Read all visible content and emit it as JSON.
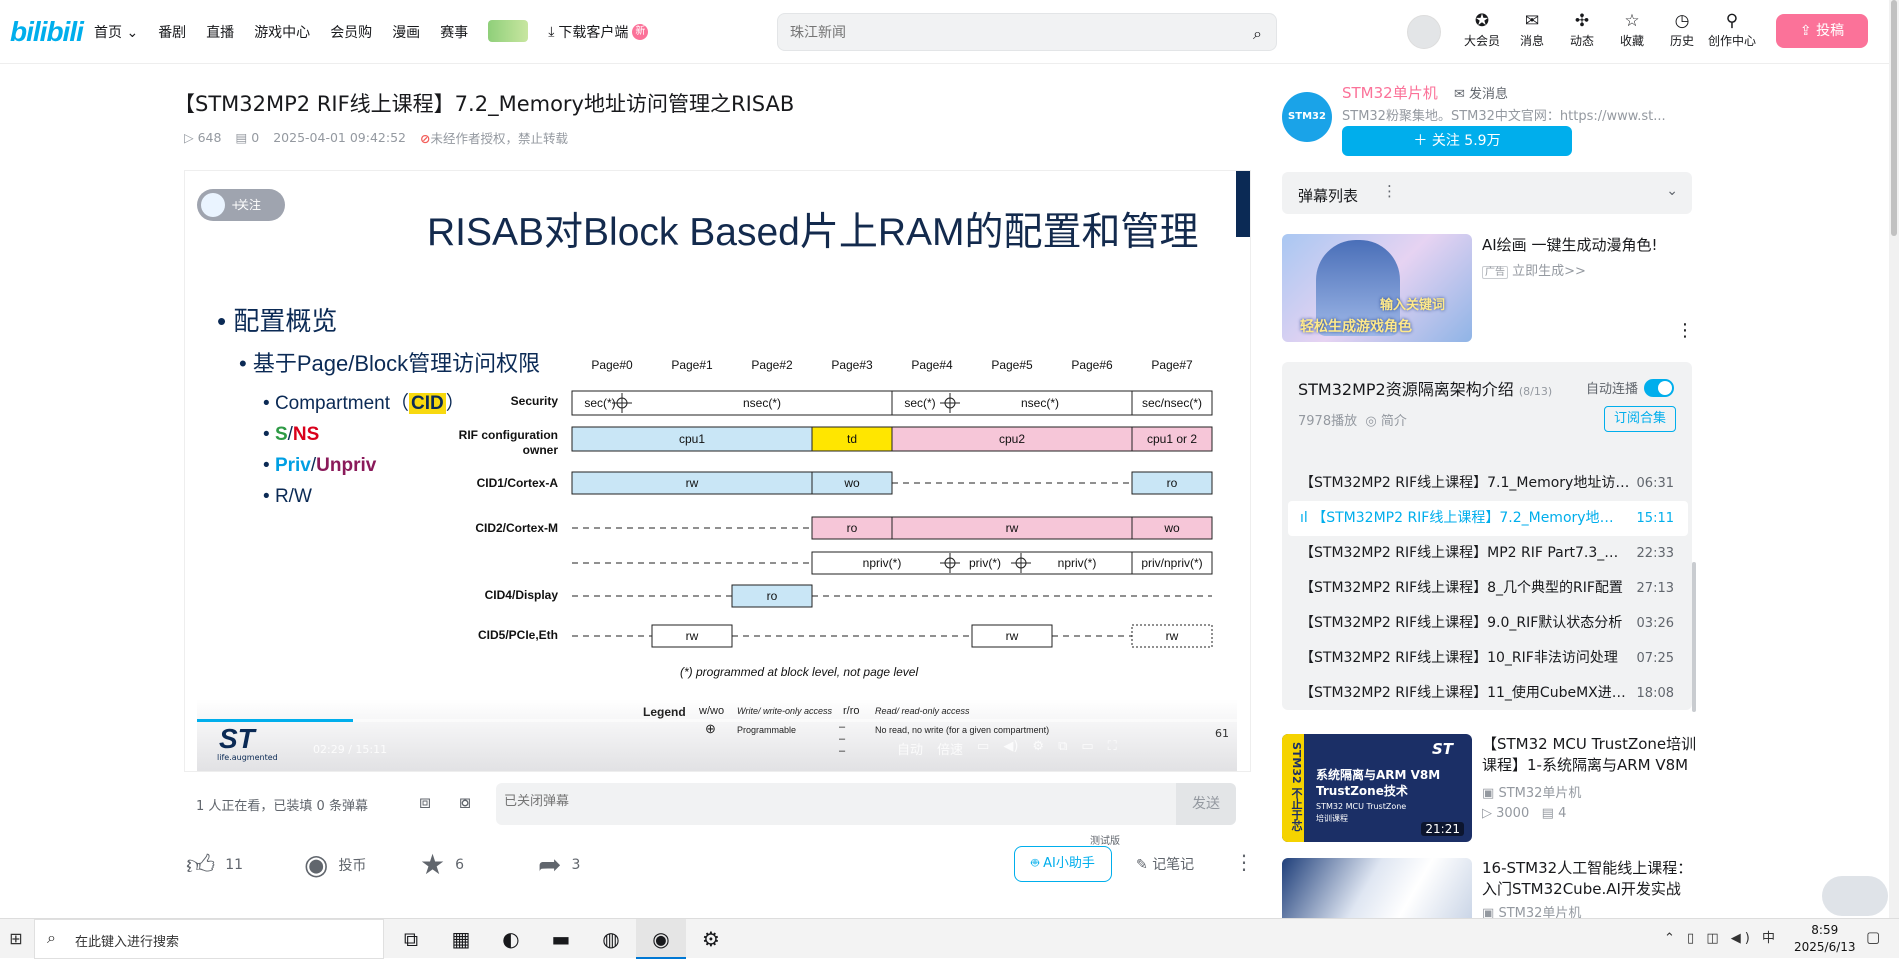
{
  "header": {
    "logo": "bilibili",
    "nav": [
      "首页",
      "番剧",
      "直播",
      "游戏中心",
      "会员购",
      "漫画",
      "赛事"
    ],
    "download_label": "下载客户端",
    "download_badge": "新",
    "search_placeholder": "珠江新闻",
    "icons": [
      {
        "icon": "vip-icon",
        "label": "大会员"
      },
      {
        "icon": "message-icon",
        "label": "消息"
      },
      {
        "icon": "dynamic-icon",
        "label": "动态"
      },
      {
        "icon": "favorite-icon",
        "label": "收藏"
      },
      {
        "icon": "history-icon",
        "label": "历史"
      },
      {
        "icon": "creator-icon",
        "label": "创作中心"
      }
    ],
    "upload_label": "投稿"
  },
  "video": {
    "title": "【STM32MP2 RIF线上课程】7.2_Memory地址访问管理之RISAB",
    "plays": "648",
    "danmaku_count": "0",
    "date": "2025-04-01 09:42:52",
    "notice": "未经作者授权，禁止转载",
    "progress_fraction": 0.15,
    "time_current": "02:29",
    "time_total": "15:11",
    "controls": [
      "自动",
      "倍速"
    ]
  },
  "slide": {
    "follow_label": "关注",
    "title": "RISAB对Block Based片上RAM的配置和管理",
    "bullet1": "配置概览",
    "bullet2": "基于Page/Block管理访问权限",
    "bullet3_prefix": "Compartment（",
    "bullet3_cid": "CID",
    "bullet3_suffix": "）",
    "s_label": "S",
    "ns_label": "NS",
    "priv_label": "Priv",
    "unpriv_label": "Unpriv",
    "slash": "/",
    "rw_label": "R/W",
    "pages": [
      "Page#0",
      "Page#1",
      "Page#2",
      "Page#3",
      "Page#4",
      "Page#5",
      "Page#6",
      "Page#7"
    ],
    "row_labels": {
      "security": "Security",
      "owner1": "RIF configuration",
      "owner2": "owner",
      "cid1": "CID1/Cortex-A",
      "cid2": "CID2/Cortex-M",
      "cid4": "CID4/Display",
      "cid5": "CID5/PCIe,Eth"
    },
    "cells": {
      "sec1": "sec(*)",
      "nsec1": "nsec(*)",
      "sec2": "sec(*)",
      "nsec2": "nsec(*)",
      "secnsec": "sec/nsec(*)",
      "cpu1": "cpu1",
      "td": "td",
      "cpu2": "cpu2",
      "cpu1or2": "cpu1 or 2",
      "rw": "rw",
      "wo": "wo",
      "ro": "ro",
      "npriv1": "npriv(*)",
      "priv": "priv(*)",
      "npriv2": "npriv(*)",
      "privnpriv": "priv/npriv(*)"
    },
    "footnote": "(*) programmed at block level, not page level",
    "legend_title": "Legend",
    "legend_wwo": "w/wo",
    "legend_wwo_desc": "Write/ write-only access",
    "legend_rro": "r/ro",
    "legend_rro_desc": "Read/ read-only access",
    "legend_prog": "Programmable",
    "legend_none": "No read, no write (for a given compartment)",
    "st_logo": "ST",
    "st_tag": "life.augmented",
    "page_num": "61"
  },
  "danmaku_bar": {
    "info": "1 人正在看，已装填 0 条弹幕",
    "placeholder": "已关闭弹幕",
    "send": "发送"
  },
  "toolbar": {
    "like": "11",
    "coin": "投币",
    "fav": "6",
    "share": "3",
    "ai_tag": "测试版",
    "ai_label": "AI小助手",
    "note": "记笔记"
  },
  "up": {
    "name": "STM32单片机",
    "message": "发消息",
    "desc": "STM32粉聚集地。STM32中文官网：https://www.st...",
    "follow": "＋ 关注 5.9万",
    "avatar_text": "STM32"
  },
  "danmaku_list": {
    "title": "弹幕列表"
  },
  "ad": {
    "title": "AI绘画 一键生成动漫角色!",
    "tag": "广告",
    "cta": "立即生成>>",
    "line1": "输入关键词",
    "line2": "轻松生成游戏角色"
  },
  "playlist": {
    "title": "STM32MP2资源隔离架构介绍",
    "count": "(8/13)",
    "auto": "自动连播",
    "plays": "7978播放",
    "intro": "简介",
    "subscribe": "订阅合集",
    "items": [
      {
        "title": "【STM32MP2 RIF线上课程】7.1_Memory地址访问管理之",
        "dur": "06:31"
      },
      {
        "title": "【STM32MP2 RIF线上课程】7.2_Memory地址访问管理之RISAB",
        "dur": "15:11"
      },
      {
        "title": "【STM32MP2 RIF线上课程】MP2 RIF Part7.3_Memory",
        "dur": "22:33"
      },
      {
        "title": "【STM32MP2 RIF线上课程】8_几个典型的RIF配置",
        "dur": "27:13"
      },
      {
        "title": "【STM32MP2 RIF线上课程】9.0_RIF默认状态分析",
        "dur": "03:26"
      },
      {
        "title": "【STM32MP2 RIF线上课程】10_RIF非法访问处理",
        "dur": "07:25"
      },
      {
        "title": "【STM32MP2 RIF线上课程】11_使用CubeMX进行配置",
        "dur": "18:08"
      }
    ]
  },
  "recs": [
    {
      "title": "【STM32 MCU TrustZone培训课程】1-系统隔离与ARM V8M",
      "up": "STM32单片机",
      "plays": "3000",
      "comments": "4",
      "dur": "21:21",
      "thumb_line1": "系统隔离与ARM V8M",
      "thumb_line2": "TrustZone技术",
      "thumb_line3": "STM32 MCU TrustZone",
      "thumb_line4": "培训课程",
      "thumb_side": "STM32 不止于芯"
    },
    {
      "title": "16-STM32人工智能线上课程：入门STM32Cube.AI开发实战",
      "up": "STM32单片机"
    }
  ],
  "taskbar": {
    "search": "在此键入进行搜索",
    "tray_ime": "中",
    "time": "8:59",
    "date": "2025/6/13"
  }
}
